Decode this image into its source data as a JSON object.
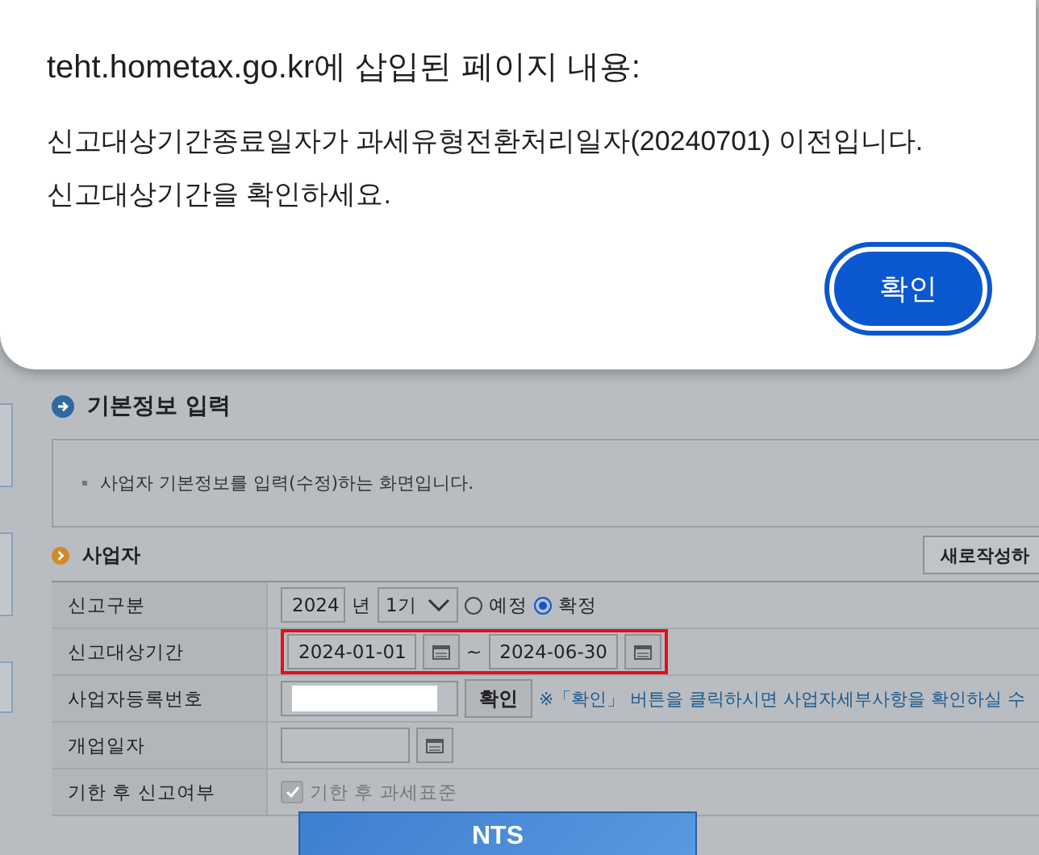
{
  "dialog": {
    "title": "teht.hometax.go.kr에 삽입된 페이지 내용:",
    "message": "신고대상기간종료일자가 과세유형전환처리일자(20240701) 이전입니다. 신고대상기간을 확인하세요.",
    "ok_button": "확인"
  },
  "page": {
    "section_title": "기본정보 입력",
    "info_text": "사업자 기본정보를 입력(수정)하는 화면입니다.",
    "subsection_title": "사업자",
    "new_button": "새로작성하",
    "rows": [
      {
        "kind": "report-type",
        "label": "신고구분",
        "year": "2024",
        "year_unit": "년",
        "period": "1기",
        "options": [
          {
            "label": "예정",
            "selected": false
          },
          {
            "label": "확정",
            "selected": true
          }
        ]
      },
      {
        "kind": "date-range",
        "label": "신고대상기간",
        "start": "2024-01-01",
        "separator": "~",
        "end": "2024-06-30",
        "highlighted": true
      },
      {
        "kind": "business-number",
        "label": "사업자등록번호",
        "button": "확인",
        "note": "※「확인」 버튼을 클릭하시면 사업자세부사항을 확인하실 수"
      },
      {
        "kind": "date",
        "label": "개업일자"
      },
      {
        "kind": "checkbox",
        "label": "기한 후 신고여부",
        "option": "기한 후 과세표준",
        "checked": true,
        "disabled": true
      }
    ]
  },
  "loading_panel": {
    "text": "NTS"
  }
}
